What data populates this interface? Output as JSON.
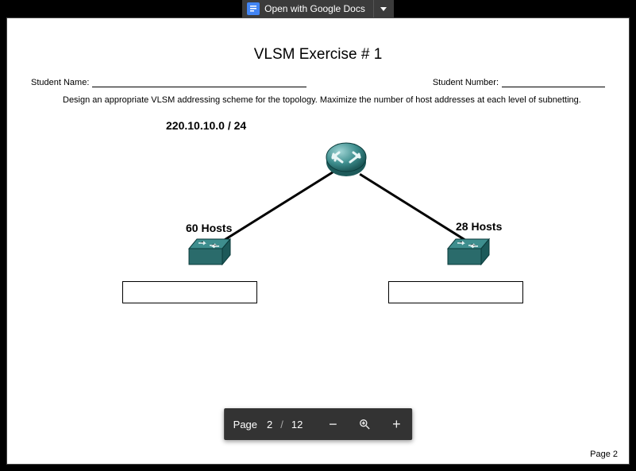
{
  "topbar": {
    "open_with_label": "Open with Google Docs"
  },
  "doc": {
    "title": "VLSM Exercise # 1",
    "student_name_label": "Student Name:",
    "student_number_label": "Student Number:",
    "instruction": "Design an appropriate VLSM addressing scheme for the topology.  Maximize the number of host addresses at each level of subnetting.",
    "network_address": "220.10.10.0 / 24",
    "hosts_left": "60 Hosts",
    "hosts_right": "28 Hosts",
    "page_footer": "Page 2"
  },
  "viewer": {
    "page_label": "Page",
    "current_page": "2",
    "page_sep": "/",
    "total_pages": "12",
    "zoom_out": "−",
    "zoom_in": "+"
  }
}
